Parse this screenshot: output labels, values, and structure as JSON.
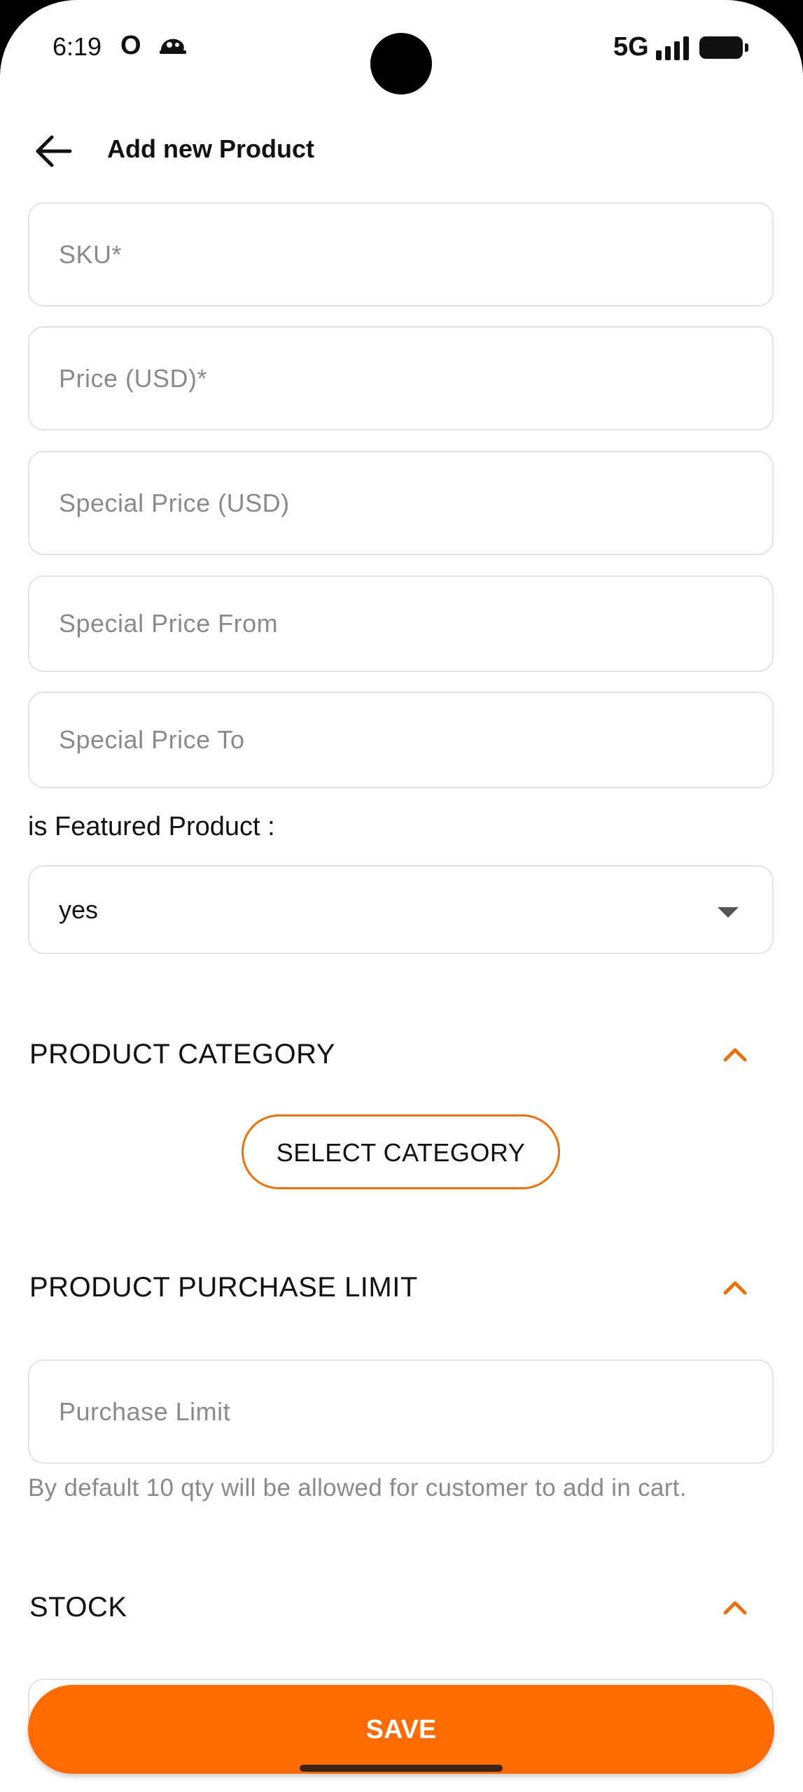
{
  "status_bar": {
    "time": "6:19",
    "notif_letter": "O",
    "network": "5G"
  },
  "app_bar": {
    "title": "Add new Product"
  },
  "form": {
    "sku_placeholder": "SKU*",
    "price_placeholder": "Price (USD)*",
    "special_price_placeholder": "Special Price (USD)",
    "special_from_placeholder": "Special Price From",
    "special_to_placeholder": "Special Price To",
    "featured_label": "is Featured Product :",
    "featured_value": "yes"
  },
  "category_section": {
    "title": "PRODUCT CATEGORY",
    "button_label": "SELECT CATEGORY"
  },
  "purchase_limit_section": {
    "title": "PRODUCT PURCHASE LIMIT",
    "placeholder": "Purchase Limit",
    "helper_text": "By default 10 qty will be allowed for customer to add in cart."
  },
  "stock_section": {
    "title": "STOCK"
  },
  "footer": {
    "save_label": "SAVE"
  },
  "colors": {
    "accent": "#ff6b00",
    "outline_accent": "#e8710a",
    "placeholder": "#8a8a8a",
    "border": "#e2e2e2"
  },
  "icons": [
    "back-arrow-icon",
    "dropdown-caret-icon",
    "chevron-up-icon",
    "signal-icon",
    "battery-icon"
  ]
}
